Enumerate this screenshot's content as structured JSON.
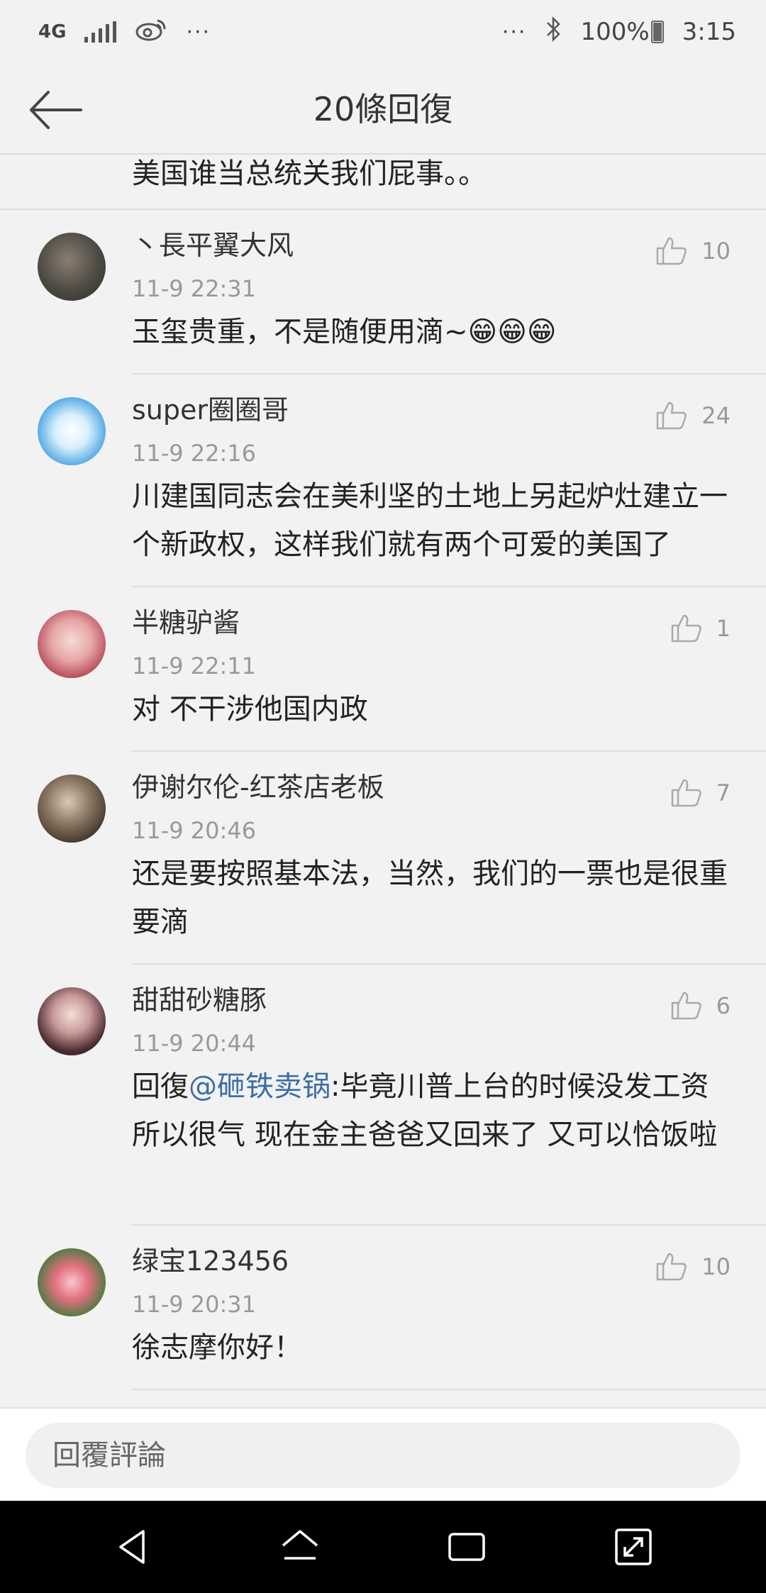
{
  "status_bar": {
    "network": "4G",
    "more_left": "···",
    "more_right": "···",
    "battery_percent": "100%",
    "time": "3:15"
  },
  "header": {
    "title": "20條回復"
  },
  "partial_comment": {
    "text": "美国谁当总统关我们屁事。。"
  },
  "comments": [
    {
      "name": "丶長平翼大风",
      "time": "11-9 22:31",
      "likes": "10",
      "text": "玉玺贵重，不是随便用滴~😁😁😁"
    },
    {
      "name": "super圈圈哥",
      "time": "11-9 22:16",
      "likes": "24",
      "text": "川建国同志会在美利坚的土地上另起炉灶建立一个新政权，这样我们就有两个可爱的美国了"
    },
    {
      "name": "半糖驴酱",
      "time": "11-9 22:11",
      "likes": "1",
      "text": "对 不干涉他国内政"
    },
    {
      "name": "伊谢尔伦-红茶店老板",
      "time": "11-9 20:46",
      "likes": "7",
      "text": "还是要按照基本法，当然，我们的一票也是很重要滴"
    },
    {
      "name": "甜甜砂糖豚",
      "time": "11-9 20:44",
      "likes": "6",
      "text_prefix": "回復",
      "mention": "@砸铁卖锅",
      "text": ":毕竟川普上台的时候没发工资 所以很气 现在金主爸爸又回来了 又可以恰饭啦"
    },
    {
      "name": "绿宝123456",
      "time": "11-9 20:31",
      "likes": "10",
      "text": "徐志摩你好！"
    }
  ],
  "reply_bar": {
    "placeholder": "回覆評論"
  },
  "colors": {
    "accent_mention": "#3b6ea8",
    "background": "#f2f2f2"
  }
}
